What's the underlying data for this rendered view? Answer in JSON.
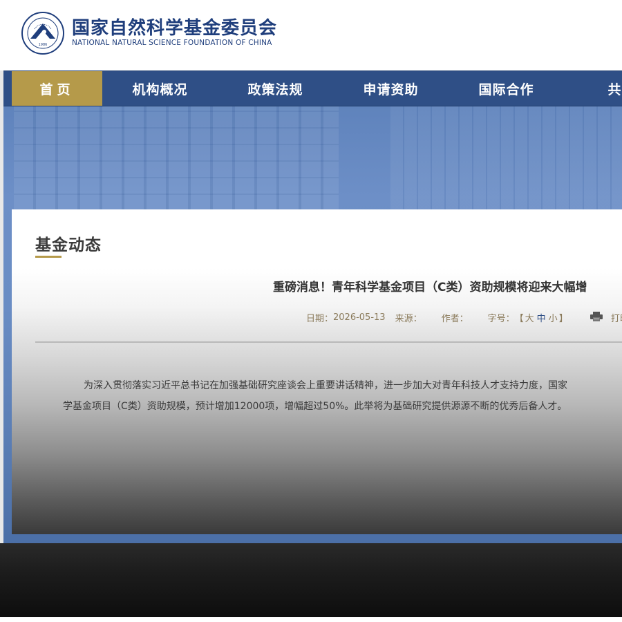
{
  "header": {
    "org_name_cn": "国家自然科学基金委员会",
    "org_name_en": "NATIONAL NATURAL SCIENCE FOUNDATION OF CHINA",
    "emblem_year": "1986"
  },
  "nav": {
    "items": [
      {
        "label": "首页",
        "active": true
      },
      {
        "label": "机构概况"
      },
      {
        "label": "政策法规"
      },
      {
        "label": "申请资助"
      },
      {
        "label": "国际合作"
      },
      {
        "label": "共享"
      }
    ]
  },
  "section": {
    "title": "基金动态"
  },
  "article": {
    "title": "重磅消息！青年科学基金项目（C类）资助规模将迎来大幅增",
    "meta": {
      "date_label": "日期：",
      "date_value": "2026-05-13",
      "source_label": "来源：",
      "author_label": "作者：",
      "fontsize_label": "字号：",
      "fontsize_open": "【",
      "fontsize_large": "大",
      "fontsize_medium": "中",
      "fontsize_small": "小",
      "fontsize_close": "】",
      "print_label": "打印"
    },
    "body_line1": "为深入贯彻落实习近平总书记在加强基础研究座谈会上重要讲话精神，进一步加大对青年科技人才支持力度，国家",
    "body_line2": "学基金项目（C类）资助规模，预计增加12000项，增幅超过50%。此举将为基础研究提供源源不断的优秀后备人才。"
  },
  "colors": {
    "nav_bg": "#2f4f86",
    "nav_active": "#b59a4a",
    "brand_blue": "#1f3e7c",
    "accent_gold": "#b59a4a"
  }
}
